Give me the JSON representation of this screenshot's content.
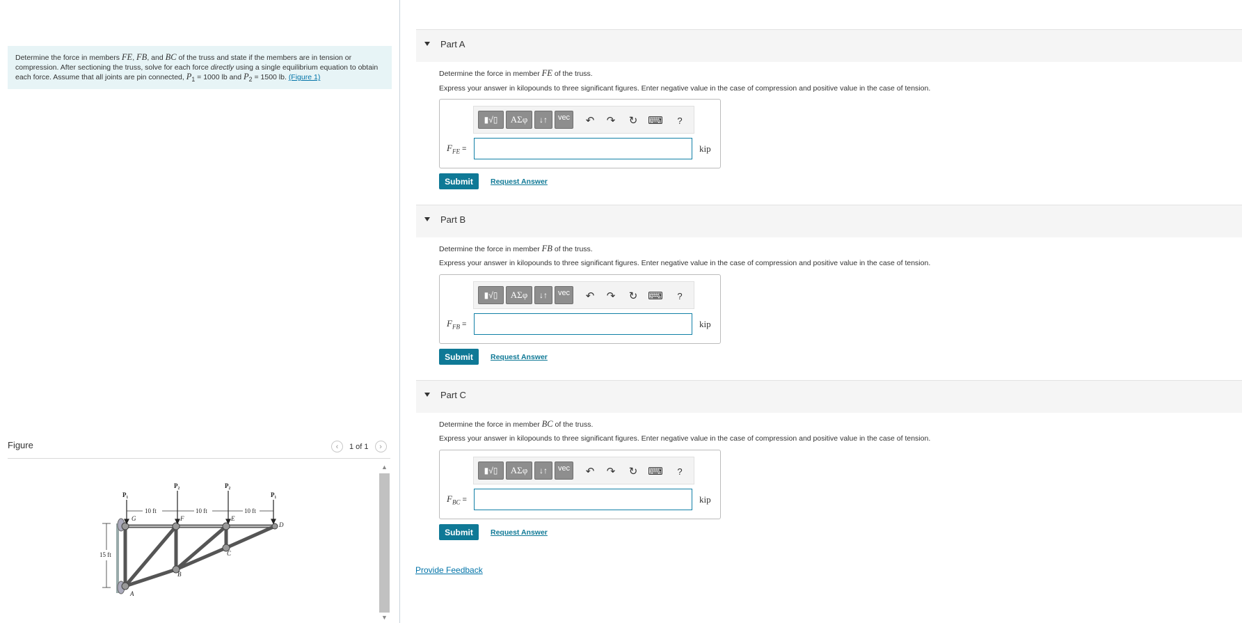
{
  "problem": {
    "text_1": "Determine the force in members ",
    "m_fe": "FE",
    "sep_1": ", ",
    "m_fb": "FB",
    "sep_2": ", and ",
    "m_bc": "BC",
    "text_2": " of the truss and state if the members are in tension or compression. After sectioning the truss, solve for each force ",
    "directly": "directly",
    "text_3": " using a single equilibrium equation to obtain each force. Assume that all joints are pin connected, ",
    "p1": "P",
    "p1_sub": "1",
    "p1_val": " = 1000 lb",
    "and": " and ",
    "p2": "P",
    "p2_sub": "2",
    "p2_val": " = 1500 lb",
    "dot": ". ",
    "figure_link": "(Figure 1)"
  },
  "figure": {
    "title": "Figure",
    "pager": "1 of 1",
    "labels": {
      "p1_left": "P₁",
      "p2_a": "P₂",
      "p2_b": "P₂",
      "p1_right": "P₁",
      "dim_1": "10 ft",
      "dim_2": "10 ft",
      "dim_3": "10 ft",
      "dim_height": "15 ft",
      "g": "G",
      "f": "F",
      "e": "E",
      "d": "D",
      "c": "C",
      "b": "B",
      "a": "A"
    }
  },
  "toolbar": {
    "templates": "▮√▯",
    "greek": "ΑΣφ",
    "arrows": "↓↑",
    "vec": "vec",
    "undo": "↶",
    "redo": "↷",
    "reset": "↻",
    "keyboard": "⌨",
    "help": "?"
  },
  "instructions": "Express your answer in kilopounds to three significant figures. Enter negative value in the case of compression and positive value in the case of tension.",
  "parts": [
    {
      "title": "Part A",
      "question_pre": "Determine the force in member ",
      "member": "FE",
      "question_post": " of the truss.",
      "var": "F",
      "var_sub": "FE",
      "eq": " =",
      "value": "",
      "unit": "kip",
      "submit": "Submit",
      "request": "Request Answer"
    },
    {
      "title": "Part B",
      "question_pre": "Determine the force in member ",
      "member": "FB",
      "question_post": " of the truss.",
      "var": "F",
      "var_sub": "FB",
      "eq": " =",
      "value": "",
      "unit": "kip",
      "submit": "Submit",
      "request": "Request Answer"
    },
    {
      "title": "Part C",
      "question_pre": "Determine the force in member ",
      "member": "BC",
      "question_post": " of the truss.",
      "var": "F",
      "var_sub": "BC",
      "eq": " =",
      "value": "",
      "unit": "kip",
      "submit": "Submit",
      "request": "Request Answer"
    }
  ],
  "feedback": "Provide Feedback"
}
